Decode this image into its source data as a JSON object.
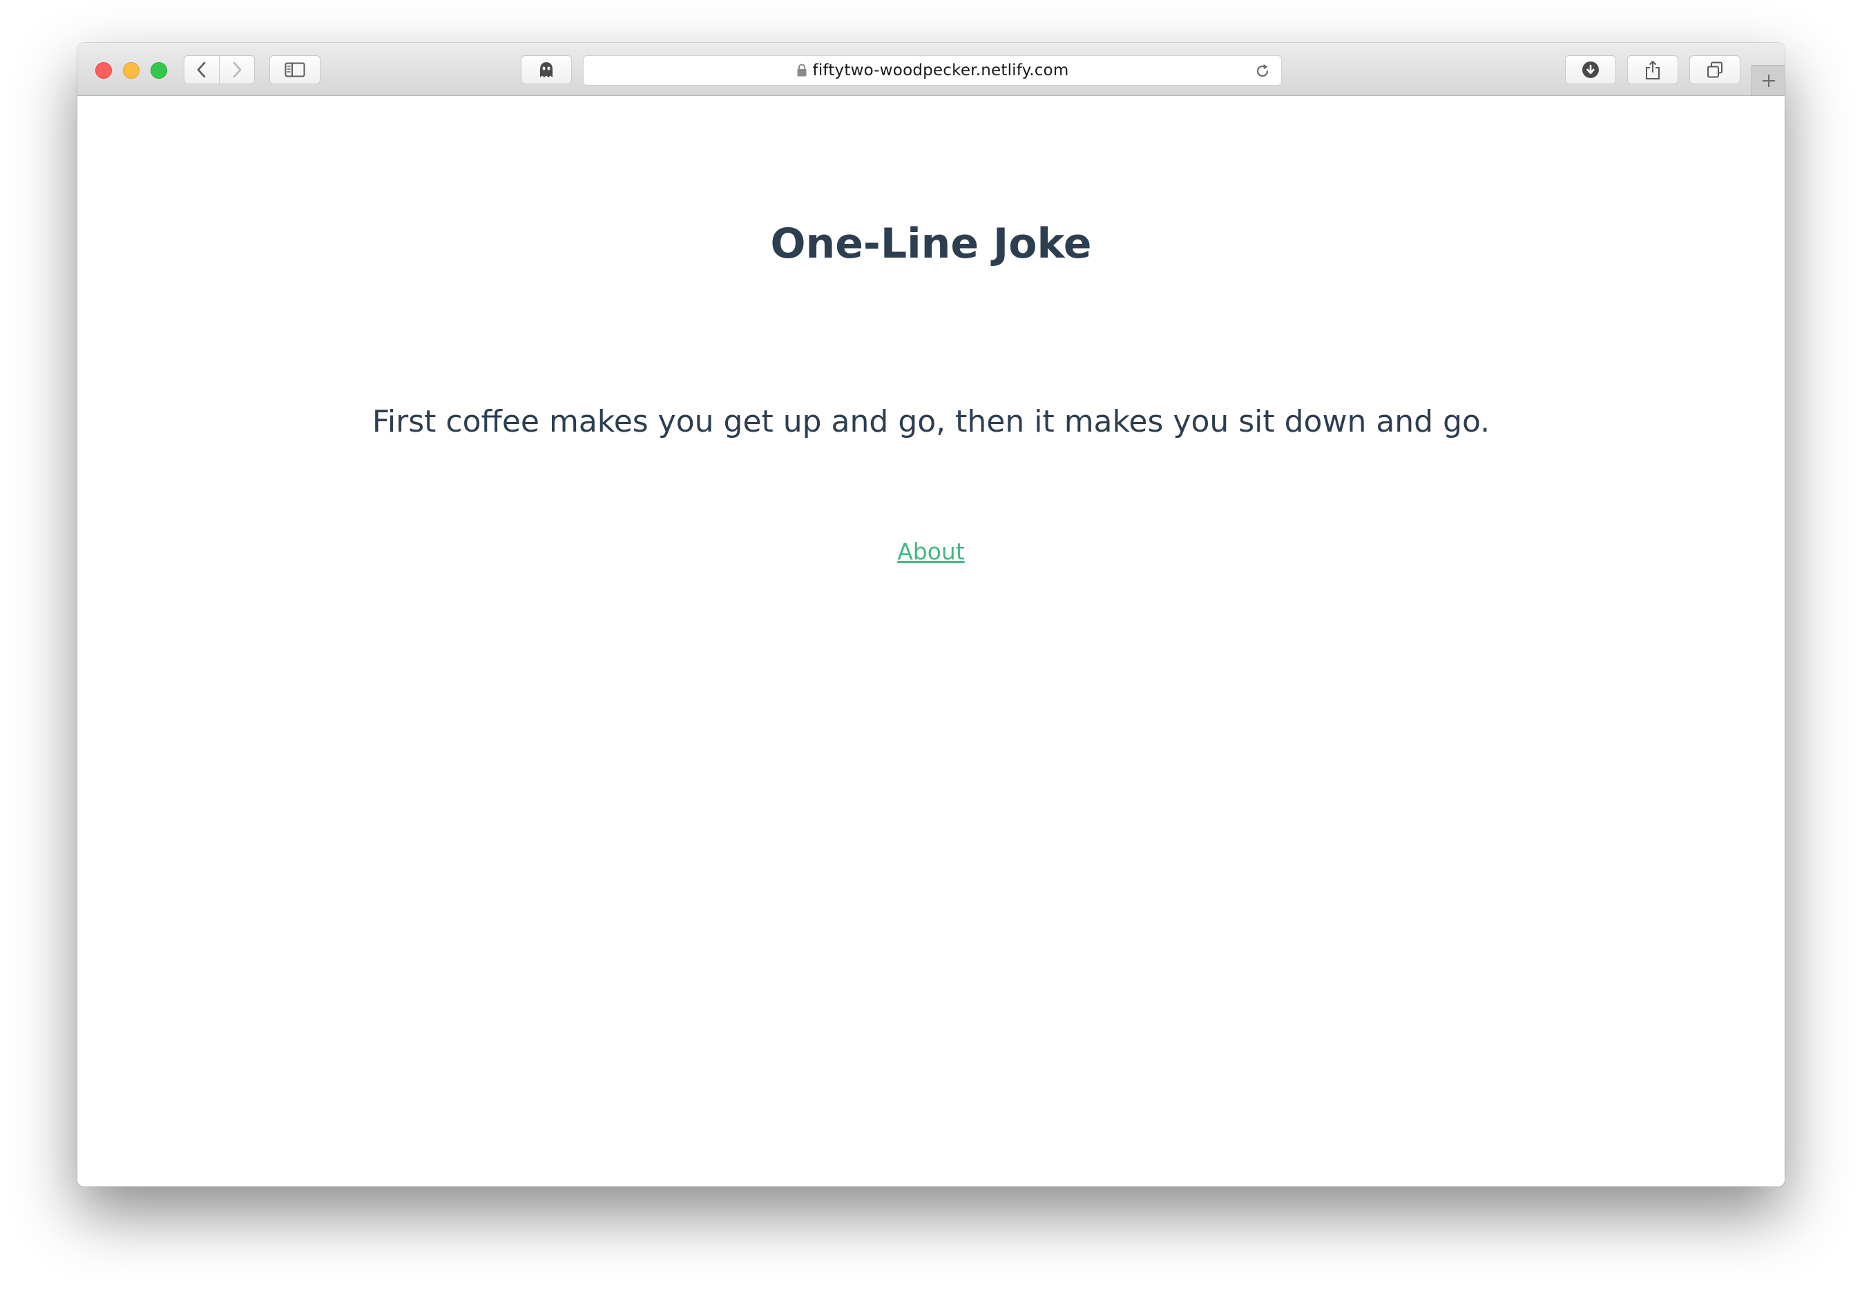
{
  "browser": {
    "url": "fiftytwo-woodpecker.netlify.com",
    "icons": {
      "back": "chevron-left-icon",
      "forward": "chevron-right-icon",
      "sidebar": "sidebar-icon",
      "ghost": "ghostery-icon",
      "lock": "lock-icon",
      "reload": "reload-icon",
      "download": "download-icon",
      "share": "share-icon",
      "tabs": "tabs-icon",
      "new_tab": "plus-icon"
    },
    "traffic_lights": [
      "#fc605c",
      "#fdbc40",
      "#34c84a"
    ]
  },
  "page": {
    "title": "One-Line Joke",
    "joke": "First coffee makes you get up and go, then it makes you sit down and go.",
    "about_link": "About"
  },
  "colors": {
    "text": "#2c3e50",
    "link": "#42b983"
  }
}
